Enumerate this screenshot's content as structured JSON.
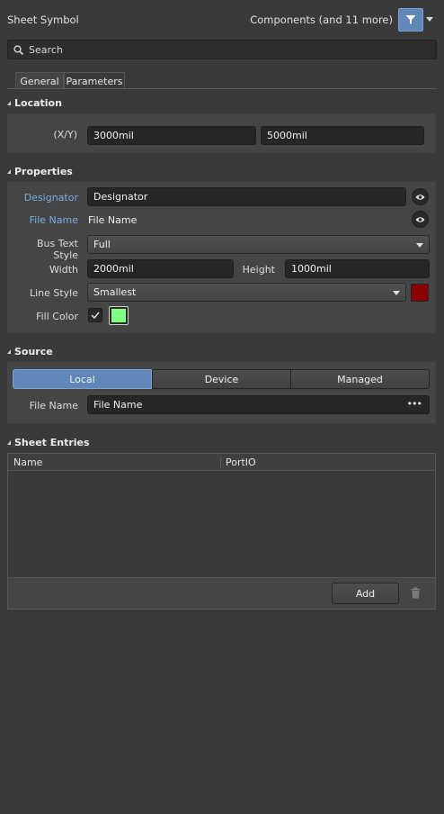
{
  "header": {
    "title": "Sheet Symbol",
    "filter_summary": "Components (and 11 more)",
    "filter_icon": "filter-icon"
  },
  "search": {
    "placeholder": "Search"
  },
  "tabs": [
    {
      "label": "General",
      "active": true
    },
    {
      "label": "Parameters",
      "active": false
    }
  ],
  "location": {
    "heading": "Location",
    "xy_label": "(X/Y)",
    "x_value": "3000mil",
    "y_value": "5000mil"
  },
  "properties": {
    "heading": "Properties",
    "designator_label": "Designator",
    "designator_value": "Designator",
    "file_name_label": "File Name",
    "file_name_value": "File Name",
    "bus_text_style_label": "Bus Text Style",
    "bus_text_style_value": "Full",
    "width_label": "Width",
    "width_value": "2000mil",
    "height_label": "Height",
    "height_value": "1000mil",
    "line_style_label": "Line Style",
    "line_style_value": "Smallest",
    "line_color": "#8b0000",
    "fill_color_label": "Fill Color",
    "fill_color_checked": true,
    "fill_color": "#80ff80"
  },
  "source": {
    "heading": "Source",
    "segments": [
      "Local",
      "Device",
      "Managed"
    ],
    "active_segment": "Local",
    "file_name_label": "File Name",
    "file_name_value": "File Name",
    "more_label": "•••"
  },
  "sheet_entries": {
    "heading": "Sheet Entries",
    "columns": [
      "Name",
      "PortIO"
    ],
    "rows": [],
    "add_label": "Add"
  },
  "colors": {
    "accent": "#5f88b8",
    "label_blue": "#7aaee6"
  }
}
